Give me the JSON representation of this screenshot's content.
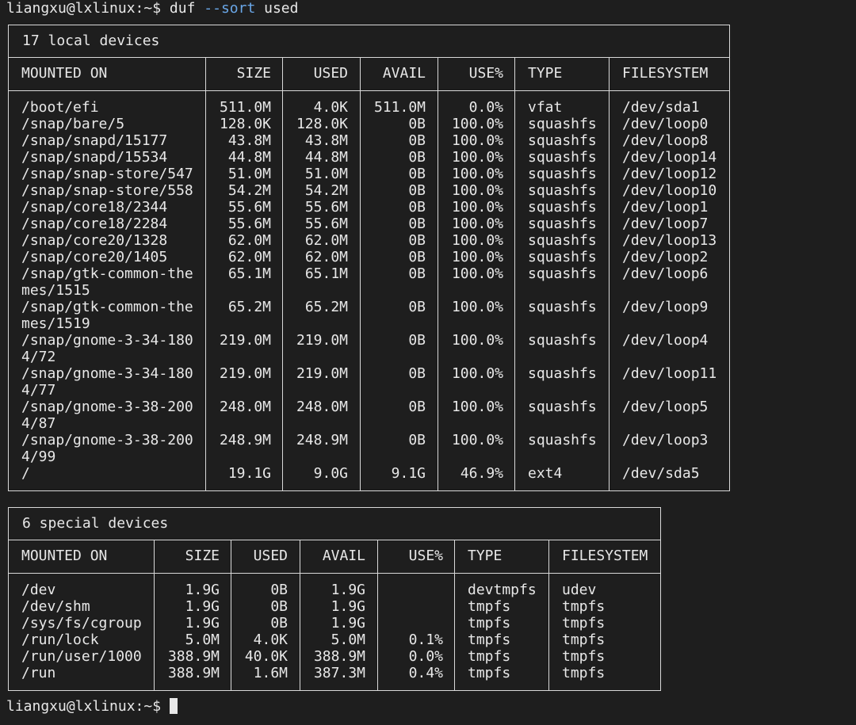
{
  "prompt": {
    "user_host": "liangxu@lxlinux:~$ ",
    "command": "duf ",
    "flag": "--sort",
    "argument": " used"
  },
  "bottom_prompt": {
    "user_host": "liangxu@lxlinux:~$ "
  },
  "local": {
    "title": "17 local devices",
    "headers": [
      "MOUNTED ON",
      "SIZE",
      "USED",
      "AVAIL",
      "USE%",
      "TYPE",
      "FILESYSTEM"
    ],
    "rows": [
      {
        "mount": "/boot/efi",
        "size": "511.0M",
        "used": "4.0K",
        "avail": "511.0M",
        "usep": "0.0%",
        "type": "vfat",
        "fs": "/dev/sda1"
      },
      {
        "mount": "/snap/bare/5",
        "size": "128.0K",
        "used": "128.0K",
        "avail": "0B",
        "usep": "100.0%",
        "type": "squashfs",
        "fs": "/dev/loop0"
      },
      {
        "mount": "/snap/snapd/15177",
        "size": "43.8M",
        "used": "43.8M",
        "avail": "0B",
        "usep": "100.0%",
        "type": "squashfs",
        "fs": "/dev/loop8"
      },
      {
        "mount": "/snap/snapd/15534",
        "size": "44.8M",
        "used": "44.8M",
        "avail": "0B",
        "usep": "100.0%",
        "type": "squashfs",
        "fs": "/dev/loop14"
      },
      {
        "mount": "/snap/snap-store/547",
        "size": "51.0M",
        "used": "51.0M",
        "avail": "0B",
        "usep": "100.0%",
        "type": "squashfs",
        "fs": "/dev/loop12"
      },
      {
        "mount": "/snap/snap-store/558",
        "size": "54.2M",
        "used": "54.2M",
        "avail": "0B",
        "usep": "100.0%",
        "type": "squashfs",
        "fs": "/dev/loop10"
      },
      {
        "mount": "/snap/core18/2344",
        "size": "55.6M",
        "used": "55.6M",
        "avail": "0B",
        "usep": "100.0%",
        "type": "squashfs",
        "fs": "/dev/loop1"
      },
      {
        "mount": "/snap/core18/2284",
        "size": "55.6M",
        "used": "55.6M",
        "avail": "0B",
        "usep": "100.0%",
        "type": "squashfs",
        "fs": "/dev/loop7"
      },
      {
        "mount": "/snap/core20/1328",
        "size": "62.0M",
        "used": "62.0M",
        "avail": "0B",
        "usep": "100.0%",
        "type": "squashfs",
        "fs": "/dev/loop13"
      },
      {
        "mount": "/snap/core20/1405",
        "size": "62.0M",
        "used": "62.0M",
        "avail": "0B",
        "usep": "100.0%",
        "type": "squashfs",
        "fs": "/dev/loop2"
      },
      {
        "mount": "/snap/gtk-common-the",
        "mount2": "mes/1515",
        "size": "65.1M",
        "used": "65.1M",
        "avail": "0B",
        "usep": "100.0%",
        "type": "squashfs",
        "fs": "/dev/loop6"
      },
      {
        "mount": "/snap/gtk-common-the",
        "mount2": "mes/1519",
        "size": "65.2M",
        "used": "65.2M",
        "avail": "0B",
        "usep": "100.0%",
        "type": "squashfs",
        "fs": "/dev/loop9"
      },
      {
        "mount": "/snap/gnome-3-34-180",
        "mount2": "4/72",
        "size": "219.0M",
        "used": "219.0M",
        "avail": "0B",
        "usep": "100.0%",
        "type": "squashfs",
        "fs": "/dev/loop4"
      },
      {
        "mount": "/snap/gnome-3-34-180",
        "mount2": "4/77",
        "size": "219.0M",
        "used": "219.0M",
        "avail": "0B",
        "usep": "100.0%",
        "type": "squashfs",
        "fs": "/dev/loop11"
      },
      {
        "mount": "/snap/gnome-3-38-200",
        "mount2": "4/87",
        "size": "248.0M",
        "used": "248.0M",
        "avail": "0B",
        "usep": "100.0%",
        "type": "squashfs",
        "fs": "/dev/loop5"
      },
      {
        "mount": "/snap/gnome-3-38-200",
        "mount2": "4/99",
        "size": "248.9M",
        "used": "248.9M",
        "avail": "0B",
        "usep": "100.0%",
        "type": "squashfs",
        "fs": "/dev/loop3"
      },
      {
        "mount": "/",
        "size": "19.1G",
        "used": "9.0G",
        "avail": "9.1G",
        "usep": "46.9%",
        "type": "ext4",
        "fs": "/dev/sda5"
      }
    ]
  },
  "special": {
    "title": "6 special devices",
    "headers": [
      "MOUNTED ON",
      "SIZE",
      "USED",
      "AVAIL",
      "USE%",
      "TYPE",
      "FILESYSTEM"
    ],
    "rows": [
      {
        "mount": "/dev",
        "size": "1.9G",
        "used": "0B",
        "avail": "1.9G",
        "usep": "",
        "type": "devtmpfs",
        "fs": "udev"
      },
      {
        "mount": "/dev/shm",
        "size": "1.9G",
        "used": "0B",
        "avail": "1.9G",
        "usep": "",
        "type": "tmpfs",
        "fs": "tmpfs"
      },
      {
        "mount": "/sys/fs/cgroup",
        "size": "1.9G",
        "used": "0B",
        "avail": "1.9G",
        "usep": "",
        "type": "tmpfs",
        "fs": "tmpfs"
      },
      {
        "mount": "/run/lock",
        "size": "5.0M",
        "used": "4.0K",
        "avail": "5.0M",
        "usep": "0.1%",
        "type": "tmpfs",
        "fs": "tmpfs"
      },
      {
        "mount": "/run/user/1000",
        "size": "388.9M",
        "used": "40.0K",
        "avail": "388.9M",
        "usep": "0.0%",
        "type": "tmpfs",
        "fs": "tmpfs"
      },
      {
        "mount": "/run",
        "size": "388.9M",
        "used": "1.6M",
        "avail": "387.3M",
        "usep": "0.4%",
        "type": "tmpfs",
        "fs": "tmpfs"
      }
    ]
  }
}
